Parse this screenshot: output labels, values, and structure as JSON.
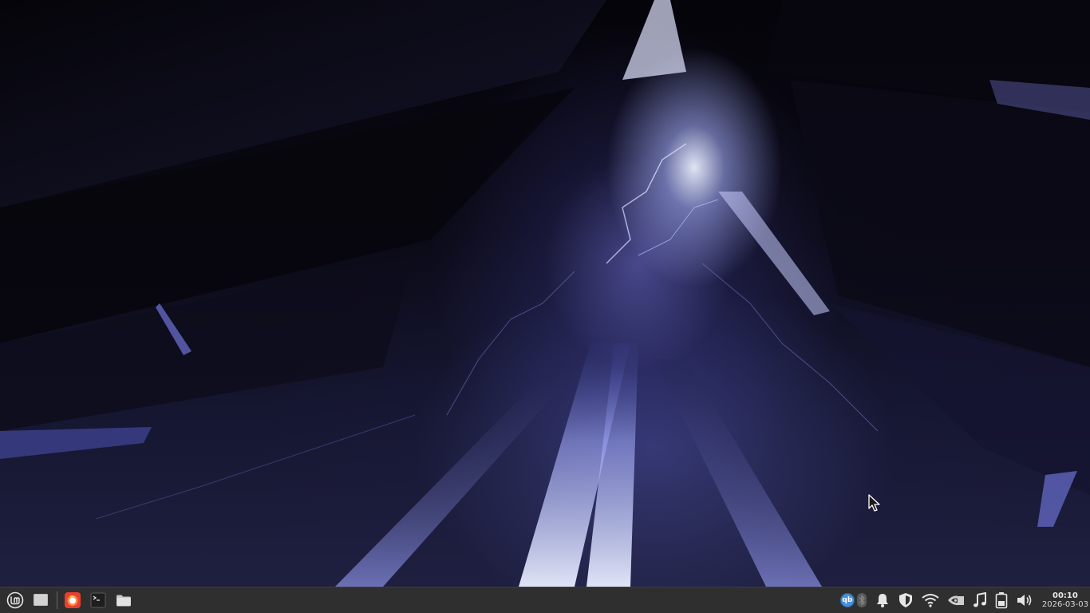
{
  "desktop": {
    "wallpaper_icon": "abstract-wallpaper",
    "accent_colors": [
      "#05040a",
      "#3a3c8e",
      "#8f93ff",
      "#eef1ff"
    ]
  },
  "taskbar": {
    "background": "#2f2f2f",
    "launchers": [
      {
        "name": "mint-menu",
        "icon": "linux-mint-logo-icon"
      },
      {
        "name": "show-desktop",
        "icon": "desktop-icon"
      },
      {
        "name": "firefox",
        "icon": "firefox-icon"
      },
      {
        "name": "terminal",
        "icon": "terminal-icon"
      },
      {
        "name": "files",
        "icon": "folder-icon"
      }
    ],
    "tray": {
      "qbittorrent_label": "qb",
      "icons": [
        "bluetooth-icon",
        "bell-icon",
        "shield-icon",
        "wifi-icon",
        "nvidia-icon",
        "music-icon",
        "battery-icon",
        "volume-icon"
      ]
    },
    "clock": {
      "time": "00:10",
      "date": "2026-03-03"
    }
  }
}
